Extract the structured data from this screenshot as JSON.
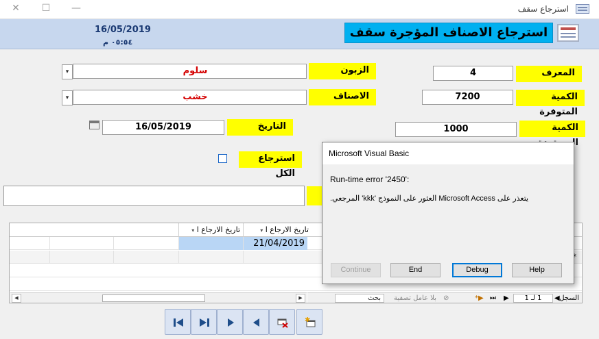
{
  "window": {
    "title": "استرجاع سقف",
    "minimize": "—",
    "maximize": "☐",
    "close": "✕"
  },
  "header": {
    "date": "16/05/2019",
    "time": "٠٥:٥٤ م",
    "title": "استرجاع الاصناف المؤجرة سقف"
  },
  "form": {
    "customer_label": "الزبون",
    "customer_value": "سلوم",
    "items_label": "الاصناف",
    "items_value": "خشب",
    "date_label": "التاريخ",
    "date_value": "16/05/2019",
    "return_all_label": "استرجاع الكل",
    "id_label": "المعرف",
    "id_value": "4",
    "available_label": "الكمية المتوفرة",
    "available_value": "7200",
    "returned_label": "الكمية المستردة",
    "returned_value": "1000"
  },
  "datasheet": {
    "columns": [
      "تاريخ الارجاع ا",
      "تاريخ الارجاع ا"
    ],
    "rows": [
      {
        "date": "21/04/2019"
      }
    ],
    "new_row_marker": "*",
    "nav": {
      "record_label": "السجل:",
      "counter": "1 لـ 1",
      "filter_label": "بلا عامل تصفية",
      "search_label": "بحث"
    }
  },
  "dialog": {
    "title": "Microsoft Visual Basic",
    "message1": "Run-time error '2450':",
    "message2": "يتعذر على Microsoft Access العثور على النموذج 'kkk' المرجعي.",
    "buttons": {
      "continue": "Continue",
      "end": "End",
      "debug": "Debug",
      "help": "Help"
    }
  },
  "icons": [
    "app-form-icon",
    "header-form-icon",
    "calendar-icon",
    "first-record-icon",
    "last-record-icon",
    "next-record-icon",
    "previous-record-icon",
    "delete-record-icon",
    "new-record-icon"
  ]
}
